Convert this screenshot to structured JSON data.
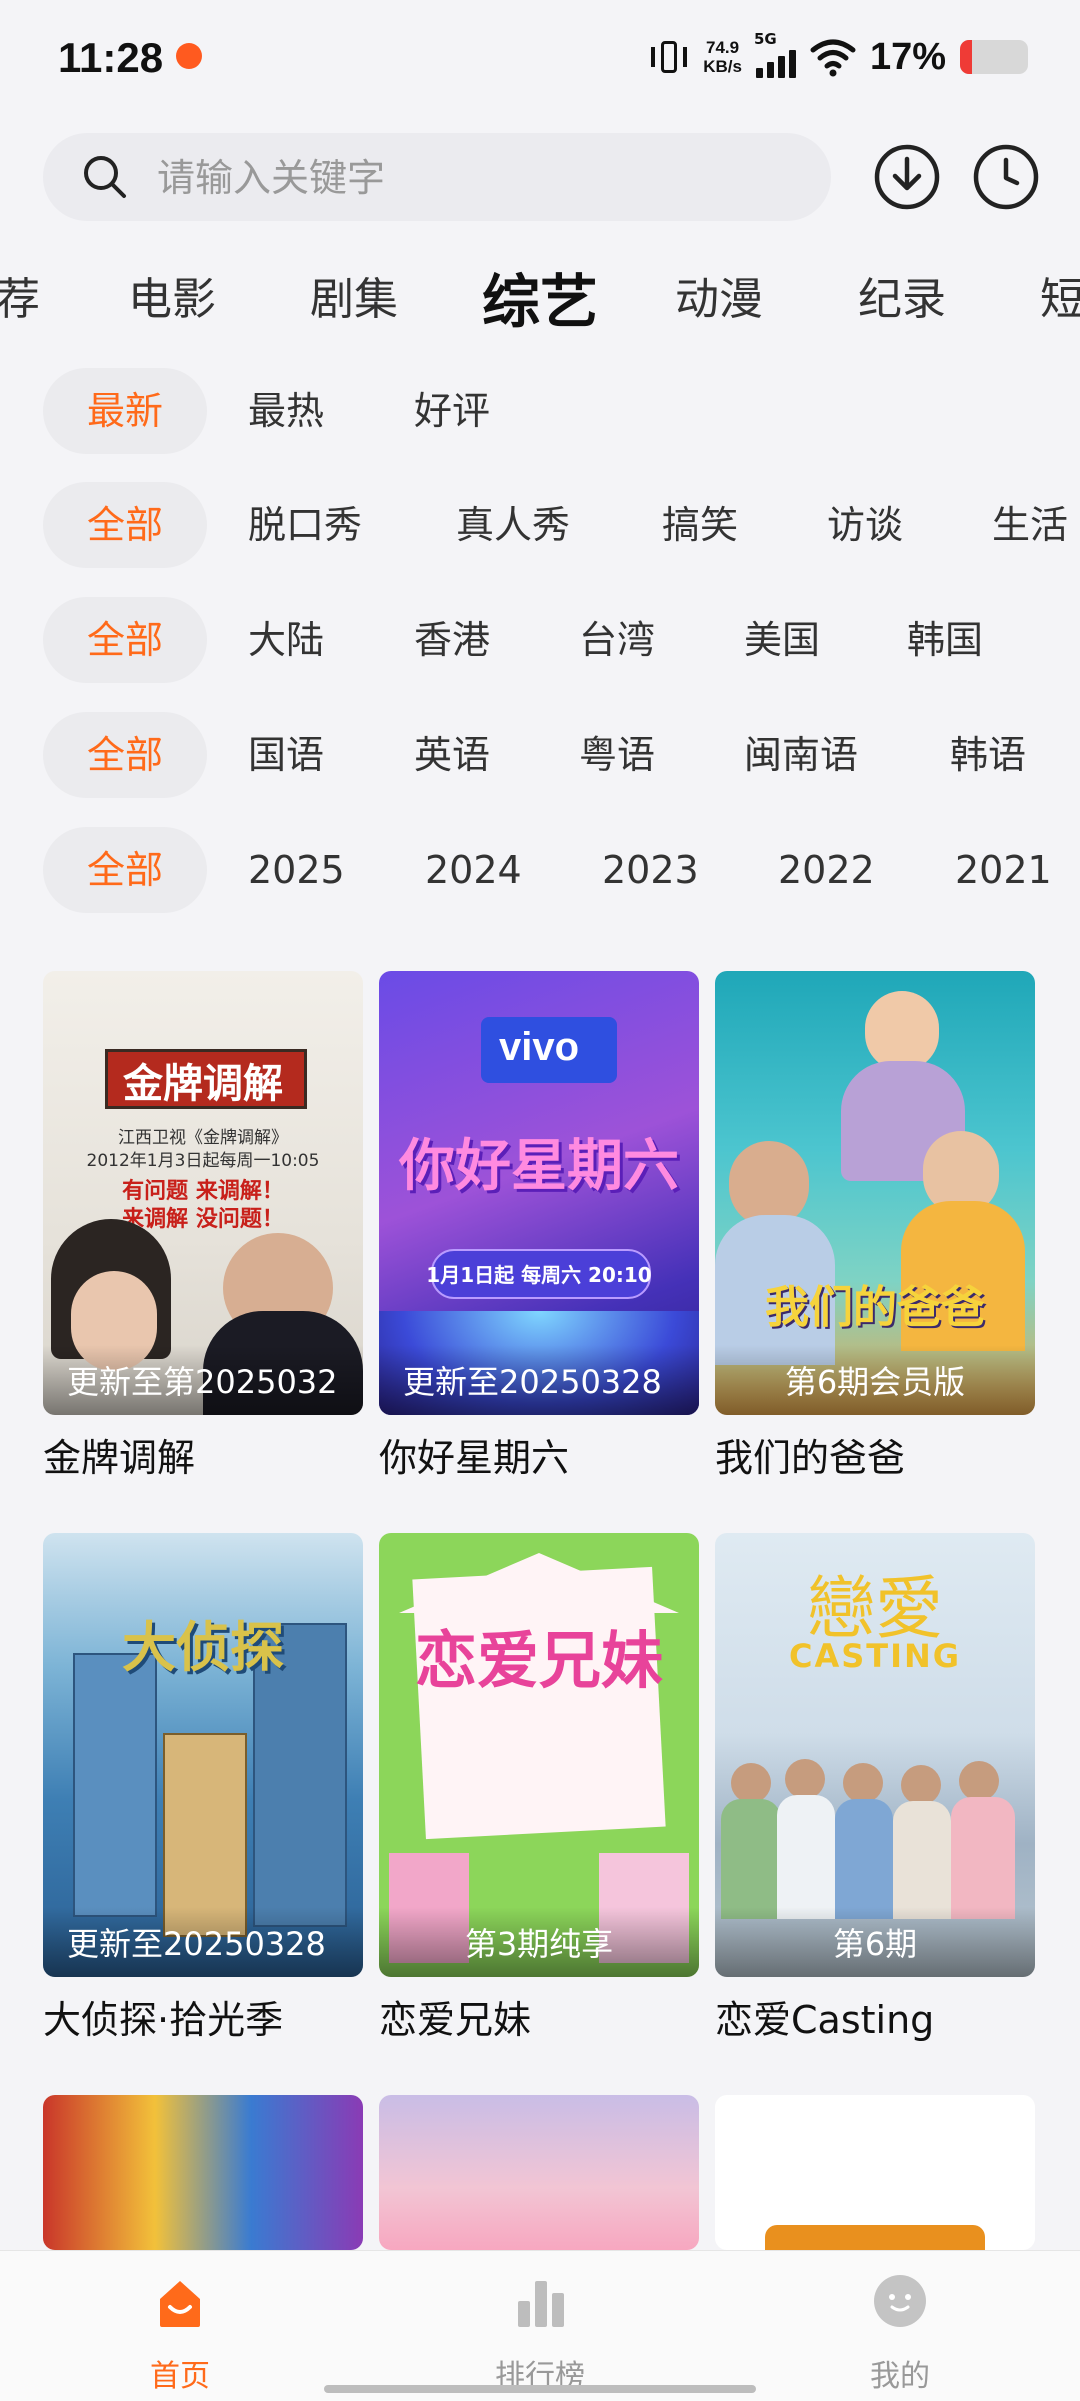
{
  "status": {
    "time": "11:28",
    "net_speed_value": "74.9",
    "net_speed_unit": "KB/s",
    "net_type": "5G",
    "battery": "17%",
    "battery_level": 0.17
  },
  "search": {
    "placeholder": "请输入关键字"
  },
  "categories": [
    {
      "label": "荐"
    },
    {
      "label": "电影"
    },
    {
      "label": "剧集"
    },
    {
      "label": "综艺",
      "active": true
    },
    {
      "label": "动漫"
    },
    {
      "label": "纪录"
    },
    {
      "label": "短"
    }
  ],
  "filters": {
    "sort": [
      "最新",
      "最热",
      "好评"
    ],
    "genre": [
      "全部",
      "脱口秀",
      "真人秀",
      "搞笑",
      "访谈",
      "生活"
    ],
    "region": [
      "全部",
      "大陆",
      "香港",
      "台湾",
      "美国",
      "韩国"
    ],
    "language": [
      "全部",
      "国语",
      "英语",
      "粤语",
      "闽南语",
      "韩语"
    ],
    "year": [
      "全部",
      "2025",
      "2024",
      "2023",
      "2022",
      "2021"
    ]
  },
  "cards": [
    {
      "title": "金牌调解",
      "badge": "更新至第2025032",
      "poster_text": "金牌调解",
      "poster_sub": "江西卫视《金牌调解》",
      "poster_date": "2012年1月3日起每周一10:05",
      "poster_line1": "有问题 来调解！",
      "poster_line2": "来调解 没问题！"
    },
    {
      "title": "你好星期六",
      "badge": "更新至20250328",
      "poster_text": "你好星期六",
      "poster_brand": "vivo",
      "poster_time": "1月1日起 每周六 20:10"
    },
    {
      "title": "我们的爸爸",
      "badge": "第6期会员版",
      "poster_text": "我们的爸爸"
    },
    {
      "title": "大侦探·拾光季",
      "badge": "更新至20250328",
      "poster_text": "大侦探"
    },
    {
      "title": "恋爱兄妹",
      "badge": "第3期纯享",
      "poster_text": "恋爱兄妹"
    },
    {
      "title": "恋爱Casting",
      "badge": "第6期",
      "poster_text": "戀愛",
      "poster_sub": "CASTING"
    }
  ],
  "nav": [
    {
      "label": "首页",
      "active": true
    },
    {
      "label": "排行榜"
    },
    {
      "label": "我的"
    }
  ],
  "colors": {
    "accent": "#ff6a1a",
    "background": "#f4f4f7"
  }
}
